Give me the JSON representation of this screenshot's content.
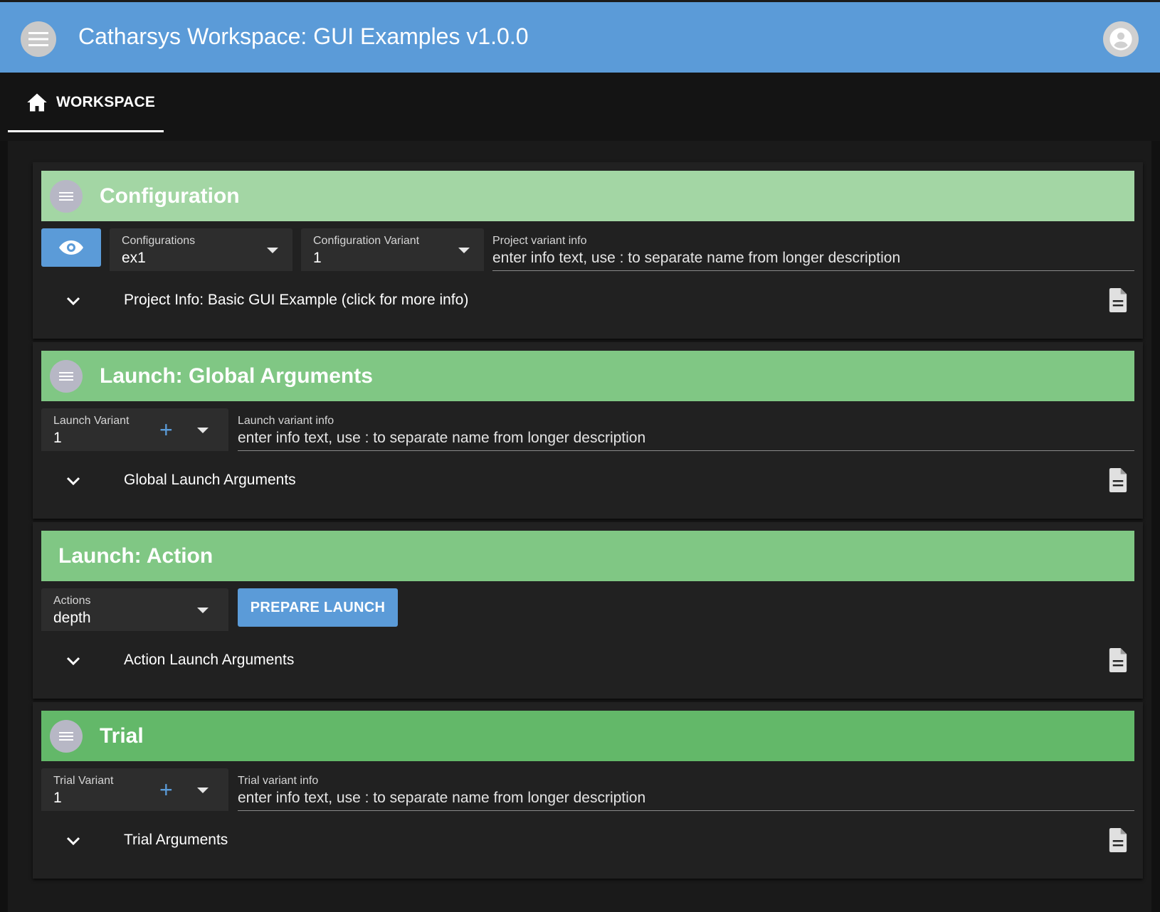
{
  "appbar": {
    "title": "Catharsys Workspace: GUI Examples v1.0.0",
    "menu_icon": "menu-icon",
    "account_icon": "account-circle-icon",
    "color": "#5b9bd8"
  },
  "tabs": [
    {
      "label": "WORKSPACE",
      "icon": "home-icon",
      "selected": true
    }
  ],
  "cards": {
    "configuration": {
      "title": "Configuration",
      "header_color": "#a3d6a4",
      "configurations": {
        "label": "Configurations",
        "value": "ex1"
      },
      "configuration_variant": {
        "label": "Configuration Variant",
        "value": "1"
      },
      "project_variant_info": {
        "label": "Project variant info",
        "value": "enter info text, use : to separate name from longer description"
      },
      "expander_label": "Project Info: Basic GUI Example (click for more info)"
    },
    "launch_global": {
      "title": "Launch: Global Arguments",
      "header_color": "#80c784",
      "launch_variant": {
        "label": "Launch Variant",
        "value": "1"
      },
      "launch_variant_info": {
        "label": "Launch variant info",
        "value": "enter info text, use : to separate name from longer description"
      },
      "expander_label": "Global Launch Arguments"
    },
    "launch_action": {
      "title": "Launch: Action",
      "header_color": "#80c784",
      "actions": {
        "label": "Actions",
        "value": "depth"
      },
      "prepare_button": "PREPARE LAUNCH",
      "expander_label": "Action Launch Arguments"
    },
    "trial": {
      "title": "Trial",
      "header_color": "#63b869",
      "trial_variant": {
        "label": "Trial Variant",
        "value": "1"
      },
      "trial_variant_info": {
        "label": "Trial variant info",
        "value": "enter info text, use : to separate name from longer description"
      },
      "expander_label": "Trial Arguments"
    }
  }
}
